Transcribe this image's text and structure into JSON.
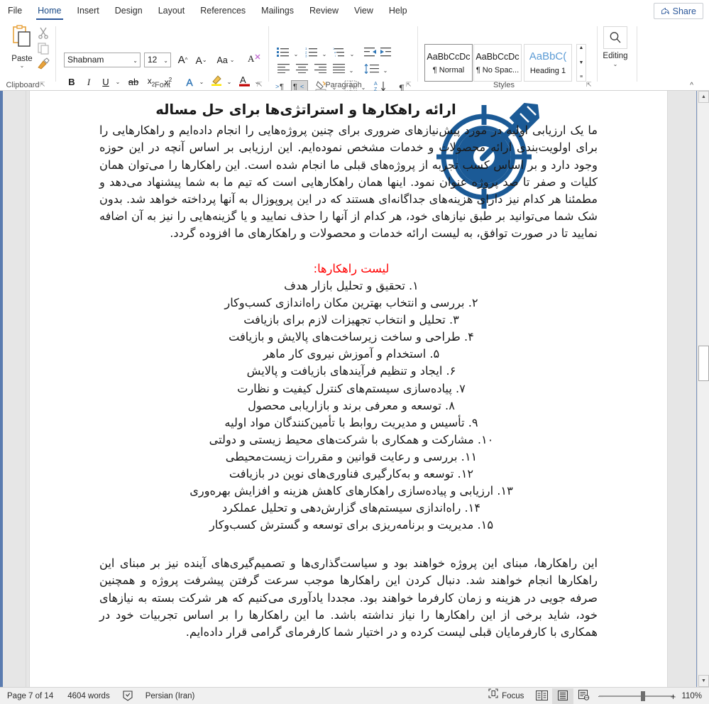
{
  "tabs": [
    {
      "label": "File",
      "active": false
    },
    {
      "label": "Home",
      "active": true
    },
    {
      "label": "Insert",
      "active": false
    },
    {
      "label": "Design",
      "active": false
    },
    {
      "label": "Layout",
      "active": false
    },
    {
      "label": "References",
      "active": false
    },
    {
      "label": "Mailings",
      "active": false
    },
    {
      "label": "Review",
      "active": false
    },
    {
      "label": "View",
      "active": false
    },
    {
      "label": "Help",
      "active": false
    }
  ],
  "share": {
    "label": "Share",
    "icon": "share-icon"
  },
  "ribbon": {
    "clipboard": {
      "label": "Clipboard",
      "paste_label": "Paste",
      "paste_icon": "paste-clipboard-icon",
      "cut_icon": "scissors-icon",
      "copy_icon": "copy-icon",
      "format_painter_icon": "format-painter-icon",
      "dialog_launcher": "dialog-launcher-icon"
    },
    "font": {
      "label": "Font",
      "font_name": "Shabnam",
      "font_size": "12",
      "grow_font_icon": "grow-font-icon",
      "shrink_font_icon": "shrink-font-icon",
      "change_case_icon": "change-case-icon",
      "clear_formatting_icon": "clear-formatting-icon",
      "bold_icon": "bold-icon",
      "italic_icon": "italic-icon",
      "underline_icon": "underline-icon",
      "strikethrough_icon": "strikethrough-icon",
      "subscript_icon": "subscript-icon",
      "superscript_icon": "superscript-icon",
      "text_effects_icon": "text-effects-icon",
      "highlight_icon": "text-highlight-icon",
      "font_color_icon": "font-color-icon",
      "dialog_launcher": "dialog-launcher-icon"
    },
    "paragraph": {
      "label": "Paragraph",
      "bullets_icon": "bullet-list-icon",
      "numbering_icon": "numbered-list-icon",
      "multilevel_icon": "multilevel-list-icon",
      "decrease_indent_icon": "decrease-indent-icon",
      "increase_indent_icon": "increase-indent-icon",
      "align_left_icon": "align-left-icon",
      "align_center_icon": "align-center-icon",
      "align_right_icon": "align-right-icon",
      "justify_icon": "justify-icon",
      "line_spacing_icon": "line-spacing-icon",
      "ltr_icon": "left-to-right-text-icon",
      "rtl_icon": "right-to-left-text-icon",
      "shading_icon": "shading-icon",
      "borders_icon": "borders-icon",
      "sort_icon": "sort-az-icon",
      "show_marks_icon": "show-formatting-marks-icon",
      "dialog_launcher": "dialog-launcher-icon"
    },
    "styles": {
      "label": "Styles",
      "items": [
        {
          "sample": "AaBbCcDc",
          "name": "¶ Normal",
          "selected": true,
          "heading": false
        },
        {
          "sample": "AaBbCcDc",
          "name": "¶ No Spac...",
          "selected": false,
          "heading": false
        },
        {
          "sample": "AaBbC(",
          "name": "Heading 1",
          "selected": false,
          "heading": true
        }
      ],
      "scroll_up": "▲",
      "scroll_down": "▼",
      "more": "≡",
      "dialog_launcher": "dialog-launcher-icon"
    },
    "editing": {
      "label": "Editing",
      "icon": "search-magnifier-icon",
      "chevron": "⌄"
    },
    "collapse": "^"
  },
  "document": {
    "title": "ارائه راهکارها و استراتژی‌ها برای حل مساله",
    "paragraph1": "ما یک ارزیابی اولیه در مورد پیش‌نیازهای ضروری برای چنین پروژه‌هایی را انجام داده‌ایم و راهکارهایی را برای اولویت‌بندی ارائه محصولات و خدمات مشخص نموده‌ایم. این ارزیابی بر اساس آنچه در این حوزه وجود دارد و بر اساس کسب تجربه از پروژه‌های قبلی ما انجام شده است. این راهکارها را می‌توان همان کلیات و صفر تا صد پروژه عنوان نمود. اینها همان راهکارهایی است که تیم ما به شما پیشنهاد می‌دهد و مطمئنا هر کدام نیز دارای هزینه‌های جداگانه‌ای هستند که در این پروپوزال به آنها پرداخته خواهد شد. بدون شک شما می‌توانید بر طبق نیازهای خود، هر کدام از آنها را حذف نمایید و یا گزینه‌هایی را نیز به آن اضافه نمایید تا در صورت توافق، به لیست ارائه خدمات و محصولات و راهکارهای ما افزوده گردد.",
    "list_heading": "لیست راهکارها:",
    "list_items": [
      "۱. تحقیق و تحلیل بازار هدف",
      "۲. بررسی و انتخاب بهترین مکان راه‌اندازی کسب‌وکار",
      "۳. تحلیل و انتخاب تجهیزات لازم برای بازیافت",
      "۴. طراحی و ساخت زیرساخت‌های پالایش و بازیافت",
      "۵. استخدام و آموزش نیروی کار ماهر",
      "۶. ایجاد و تنظیم فرآیندهای بازیافت و پالایش",
      "۷. پیاده‌سازی سیستم‌های کنترل کیفیت و نظارت",
      "۸. توسعه و معرفی برند و بازاریابی محصول",
      "۹. تأسیس و مدیریت روابط با تأمین‌کنندگان مواد اولیه",
      "۱۰. مشارکت و همکاری با شرکت‌های محیط زیستی و دولتی",
      "۱۱. بررسی و رعایت قوانین و مقررات زیست‌محیطی",
      "۱۲. توسعه و به‌کارگیری فناوری‌های نوین در بازیافت",
      "۱۳. ارزیابی و پیاده‌سازی راهکارهای کاهش هزینه و افزایش بهره‌وری",
      "۱۴. راه‌اندازی سیستم‌های گزارش‌دهی و تحلیل عملکرد",
      "۱۵. مدیریت و برنامه‌ریزی برای توسعه و گسترش کسب‌وکار"
    ],
    "paragraph2": "این راهکارها، مبنای این پروژه خواهند بود و سیاست‌گذاری‌ها و تصمیم‌گیری‌های آینده نیز بر مبنای این راهکارها انجام خواهند شد. دنبال کردن این راهکارها موجب سرعت گرفتن پیشرفت پروژه و همچنین صرفه جویی در هزینه و زمان کارفرما خواهند بود. مجددا یادآوری می‌کنیم که هر شرکت بسته به نیازهای خود، شاید برخی از این راهکارها را نیاز نداشته باشد. ما این راهکارها را بر اساس تجربیات خود در همکاری با کارفرمایان قبلی لیست کرده و در اختیار شما کارفرمای گرامی قرار داده‌ایم.",
    "image": {
      "name": "target-with-arrow-icon",
      "color": "#1b5a96"
    }
  },
  "statusbar": {
    "page": "Page 7 of 14",
    "words": "4604 words",
    "proofing_icon": "proofing-errors-icon",
    "language": "Persian (Iran)",
    "focus": "Focus",
    "focus_icon": "focus-mode-icon",
    "read_mode_icon": "read-mode-icon",
    "print_layout_icon": "print-layout-icon",
    "web_layout_icon": "web-layout-icon",
    "zoom_out": "−",
    "zoom_in": "+",
    "zoom_value": "110%"
  },
  "scrollbar": {
    "up_arrow": "▲",
    "down_arrow": "▼"
  },
  "colors": {
    "accent": "#2b579a",
    "doc_accent": "#1b5a96",
    "list_heading": "#ff0000"
  }
}
